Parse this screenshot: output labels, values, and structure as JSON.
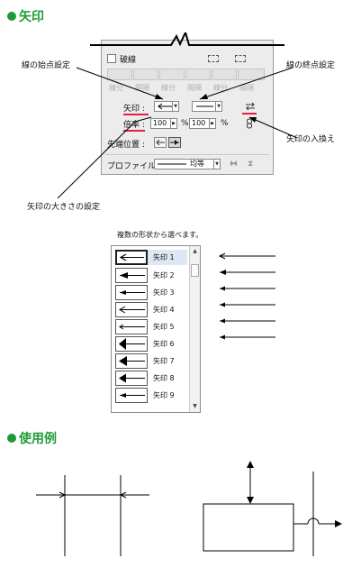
{
  "sections": {
    "arrow_title": "矢印",
    "usage_title": "使用例"
  },
  "callouts": {
    "start": "線の始点設定",
    "end": "線の終点設定",
    "swap": "矢印の入換え",
    "size": "矢印の大きさの設定",
    "choose": "複数の形状から選べます。"
  },
  "panel": {
    "dashed_label": "破線",
    "ghost_buttons": [
      "線分",
      "間隔",
      "線分",
      "間隔",
      "線分",
      "間隔"
    ],
    "arrow_label": "矢印 :",
    "scale_label": "倍率 :",
    "start_scale": "100",
    "end_scale": "100",
    "percent": "%",
    "tip_label": "先端位置 :",
    "profile_label": "プロファイル :",
    "profile_value": "均等"
  },
  "arrow_list": {
    "items": [
      "矢印 1",
      "矢印 2",
      "矢印 3",
      "矢印 4",
      "矢印 5",
      "矢印 6",
      "矢印 7",
      "矢印 8",
      "矢印 9"
    ],
    "selected_index": 0
  },
  "icons": {
    "swap": "swap-arrows-icon",
    "link": "chain-link-icon",
    "tip_inside": "arrow-tip-inside-icon",
    "tip_outside": "arrow-tip-outside-icon",
    "flip_h": "flip-horizontal-icon",
    "flip_v": "flip-vertical-icon",
    "scroll_up": "scroll-up-icon",
    "scroll_down": "scroll-down-icon"
  },
  "colors": {
    "title_green": "#1f9a36",
    "highlight_red": "#e0204a"
  }
}
